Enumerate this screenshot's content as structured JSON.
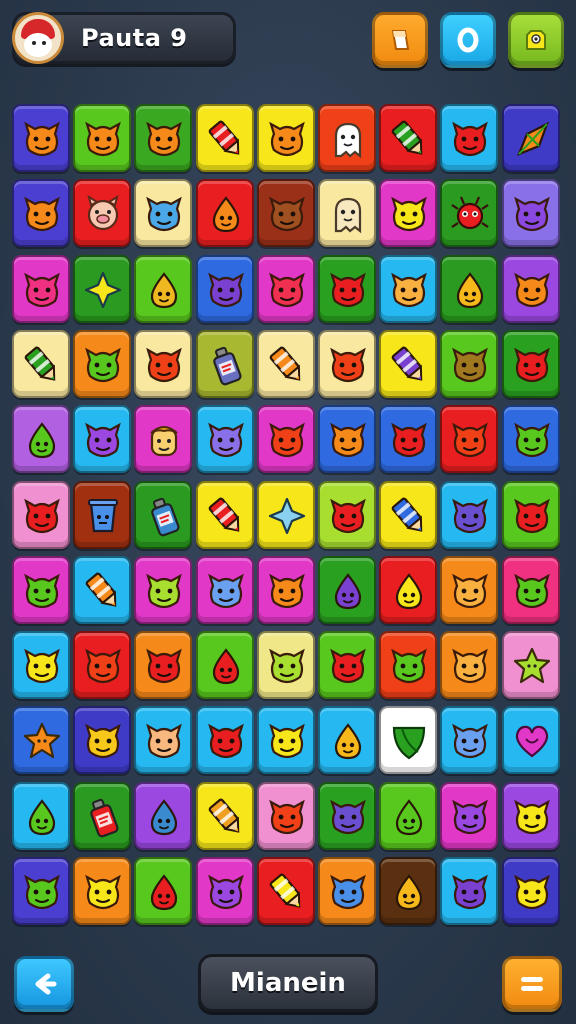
{
  "header": {
    "level_label": "Pauta 9",
    "buttons": [
      {
        "icon": "eraser-icon",
        "color": "#f39a1a"
      },
      {
        "icon": "ring-icon",
        "color": "#27b8f2"
      },
      {
        "icon": "character-icon",
        "color": "#8fcc2c"
      }
    ]
  },
  "grid": {
    "rows": 11,
    "cols": 9,
    "tiles": [
      [
        "#4a3fd0",
        "#58c81e",
        "#3aa820",
        "#f6e61a",
        "#f6e61a",
        "#f04018",
        "#e81e20",
        "#26b8f0",
        "#3f3bc6"
      ],
      [
        "#4a3fd0",
        "#e81e20",
        "#f8e8a0",
        "#e81e20",
        "#9a3018",
        "#f8e8a0",
        "#e238c8",
        "#2a9a20",
        "#8a70e8"
      ],
      [
        "#e238c8",
        "#2a9a20",
        "#58c81e",
        "#2f6ae0",
        "#e238c8",
        "#2aa020",
        "#26b8f0",
        "#2a9a20",
        "#9a48e0"
      ],
      [
        "#f8e8a0",
        "#f58a1a",
        "#f8e8a0",
        "#a8b830",
        "#f8e8a0",
        "#f8e8a0",
        "#f6e61a",
        "#58c81e",
        "#2aa020"
      ],
      [
        "#b060e0",
        "#26b8f0",
        "#e238c8",
        "#26b8f0",
        "#e238c8",
        "#2f6ae0",
        "#2f6ae0",
        "#e81e20",
        "#2f6ae0"
      ],
      [
        "#f090d0",
        "#a03010",
        "#2a9a20",
        "#f6e61a",
        "#f6e61a",
        "#a8de30",
        "#f6e61a",
        "#26b8f0",
        "#58c81e"
      ],
      [
        "#e238c8",
        "#26b8f0",
        "#e238c8",
        "#e238c8",
        "#e238c8",
        "#2aa020",
        "#e81e20",
        "#f58a1a",
        "#f03080"
      ],
      [
        "#26b8f0",
        "#e81e20",
        "#f58a1a",
        "#58c81e",
        "#f0e888",
        "#58c81e",
        "#f04018",
        "#f58a1a",
        "#f090d0"
      ],
      [
        "#2f6ae0",
        "#3f3bc6",
        "#26b8f0",
        "#26b8f0",
        "#26b8f0",
        "#26b8f0",
        "#ffffff",
        "#26b8f0",
        "#26b8f0"
      ],
      [
        "#26b8f0",
        "#2a9a20",
        "#9a48e0",
        "#f6e61a",
        "#f090d0",
        "#2aa020",
        "#58c81e",
        "#e238c8",
        "#9a48e0"
      ],
      [
        "#4a3fd0",
        "#f58a1a",
        "#58c81e",
        "#e238c8",
        "#e81e20",
        "#f58a1a",
        "#5a3010",
        "#26b8f0",
        "#3f3bc6"
      ]
    ],
    "icons": [
      [
        "monster",
        "monster",
        "monster",
        "crayon",
        "monster",
        "ghost",
        "crayon",
        "monster",
        "kite"
      ],
      [
        "monster",
        "pig",
        "monster",
        "drop",
        "monster",
        "ghost",
        "monster",
        "bug",
        "monster"
      ],
      [
        "monster",
        "star4",
        "drop",
        "monster",
        "monster",
        "monster",
        "monster",
        "drop",
        "monster"
      ],
      [
        "crayon",
        "monster",
        "monster",
        "bottle",
        "crayon",
        "monster",
        "crayon",
        "monster",
        "monster"
      ],
      [
        "drop",
        "monster",
        "face",
        "monster",
        "monster",
        "monster",
        "monster",
        "monster",
        "monster"
      ],
      [
        "monster",
        "cup",
        "bottle",
        "crayon",
        "star4",
        "monster",
        "crayon",
        "monster",
        "monster"
      ],
      [
        "monster",
        "crayon",
        "monster",
        "monster",
        "monster",
        "drop",
        "drop",
        "monster",
        "monster"
      ],
      [
        "monster",
        "monster",
        "monster",
        "drop",
        "monster",
        "monster",
        "monster",
        "monster",
        "star"
      ],
      [
        "star",
        "monster",
        "monster",
        "monster",
        "monster",
        "drop",
        "leaf",
        "monster",
        "heart"
      ],
      [
        "drop",
        "bottle",
        "drop",
        "crayon",
        "monster",
        "monster",
        "drop",
        "monster",
        "monster"
      ],
      [
        "monster",
        "monster",
        "drop",
        "monster",
        "crayon",
        "monster",
        "drop",
        "monster",
        "monster"
      ]
    ],
    "icon_colors": [
      [
        "#f58a1a",
        "#f58a1a",
        "#f58a1a",
        "#e81e20",
        "#f58a1a",
        "#ffffff",
        "#2aa020",
        "#e81e20",
        "#f58a1a"
      ],
      [
        "#f58a1a",
        "#f8c8b0",
        "#4aa8e8",
        "#f58a1a",
        "#a05020",
        "#f8e8c0",
        "#f6e61a",
        "#e81e20",
        "#8a48e0"
      ],
      [
        "#f03080",
        "#f6e61a",
        "#f0b820",
        "#7a40d0",
        "#f03050",
        "#e81e20",
        "#f8b040",
        "#f6b81a",
        "#f58a1a"
      ],
      [
        "#2aa020",
        "#58c81e",
        "#f04018",
        "#6a70c0",
        "#f58a1a",
        "#f04018",
        "#7a40d0",
        "#a07820",
        "#e81e20"
      ],
      [
        "#58c81e",
        "#9a48e0",
        "#f8d070",
        "#8a70e8",
        "#f04018",
        "#f58a1a",
        "#e81e20",
        "#f04018",
        "#58c81e"
      ],
      [
        "#e81e20",
        "#4a90e8",
        "#3a8ad0",
        "#e81e20",
        "#8ad0f0",
        "#e81e20",
        "#2f6ae0",
        "#6a50d0",
        "#e81e20"
      ],
      [
        "#58c81e",
        "#f58a1a",
        "#a8de30",
        "#6aa0f0",
        "#f58a1a",
        "#7a40d0",
        "#f6e61a",
        "#f8b040",
        "#58c81e"
      ],
      [
        "#f6e61a",
        "#f04018",
        "#e81e20",
        "#e81e20",
        "#a8de30",
        "#e81e20",
        "#58c81e",
        "#f8b040",
        "#a8de30"
      ],
      [
        "#f58a1a",
        "#f6c81a",
        "#f8b880",
        "#e81e20",
        "#f6e61a",
        "#f6b81a",
        "#2aa020",
        "#6aa0f0",
        "#e238c8"
      ],
      [
        "#58c81e",
        "#e81e20",
        "#3a8ad0",
        "#f0a020",
        "#f04018",
        "#6a50d0",
        "#58c81e",
        "#9a48e0",
        "#f6e61a"
      ],
      [
        "#58c81e",
        "#f6e61a",
        "#e81e20",
        "#9a48e0",
        "#f6e61a",
        "#4a90e8",
        "#f6b81a",
        "#7a40d0",
        "#f6e61a"
      ]
    ]
  },
  "footer": {
    "back_icon": "arrow-left-icon",
    "main_label": "Mianein",
    "menu_icon": "hamburger-icon"
  }
}
